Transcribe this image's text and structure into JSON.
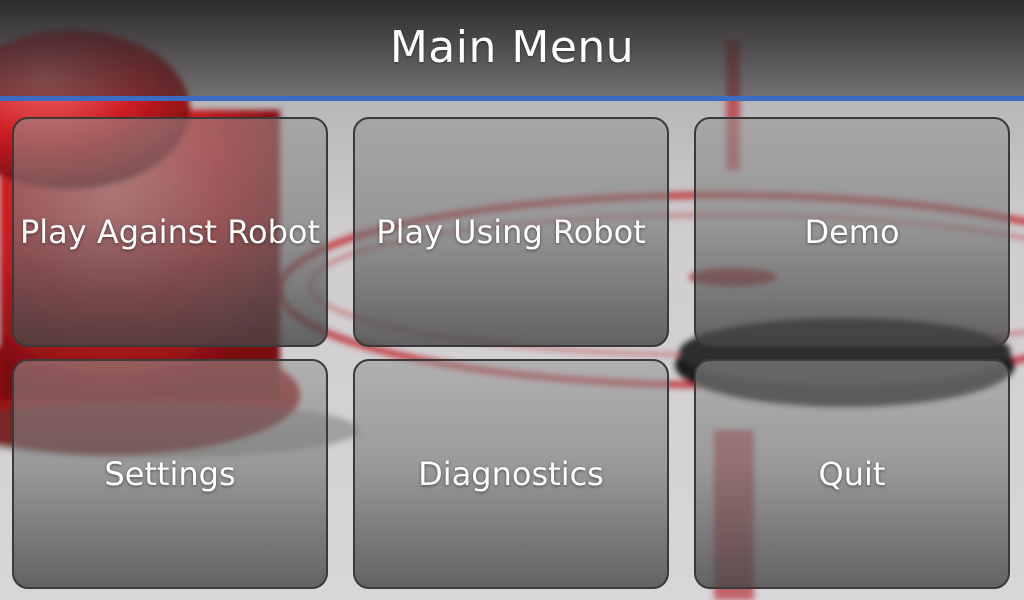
{
  "header": {
    "title": "Main Menu",
    "accent_color": "#3b6cc2"
  },
  "menu": {
    "items": [
      {
        "label": "Play Against Robot"
      },
      {
        "label": "Play Using Robot"
      },
      {
        "label": "Demo"
      },
      {
        "label": "Settings"
      },
      {
        "label": "Diagnostics"
      },
      {
        "label": "Quit"
      }
    ]
  },
  "background": {
    "table_color": "#c8c6c8",
    "line_color": "#c0282c",
    "mallet_color": "#cc1d22",
    "puck_color": "#1c1c1c"
  }
}
